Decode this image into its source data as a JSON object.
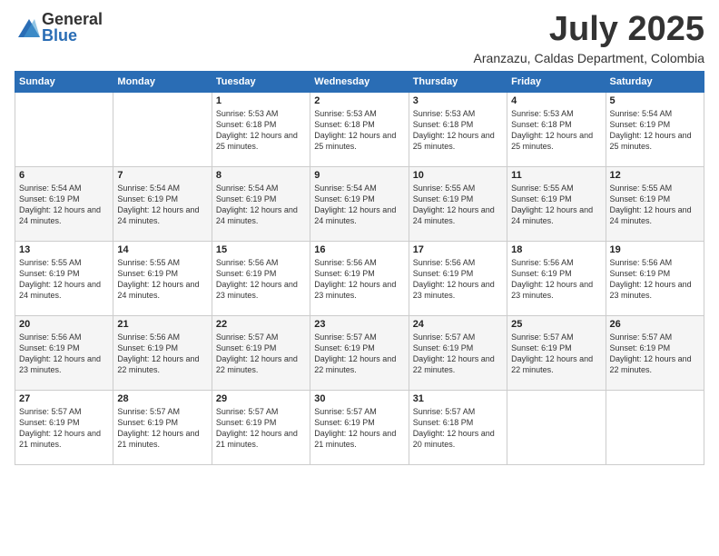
{
  "logo": {
    "general": "General",
    "blue": "Blue"
  },
  "header": {
    "month": "July 2025",
    "location": "Aranzazu, Caldas Department, Colombia"
  },
  "weekdays": [
    "Sunday",
    "Monday",
    "Tuesday",
    "Wednesday",
    "Thursday",
    "Friday",
    "Saturday"
  ],
  "weeks": [
    [
      {
        "day": "",
        "info": ""
      },
      {
        "day": "",
        "info": ""
      },
      {
        "day": "1",
        "info": "Sunrise: 5:53 AM\nSunset: 6:18 PM\nDaylight: 12 hours and 25 minutes."
      },
      {
        "day": "2",
        "info": "Sunrise: 5:53 AM\nSunset: 6:18 PM\nDaylight: 12 hours and 25 minutes."
      },
      {
        "day": "3",
        "info": "Sunrise: 5:53 AM\nSunset: 6:18 PM\nDaylight: 12 hours and 25 minutes."
      },
      {
        "day": "4",
        "info": "Sunrise: 5:53 AM\nSunset: 6:18 PM\nDaylight: 12 hours and 25 minutes."
      },
      {
        "day": "5",
        "info": "Sunrise: 5:54 AM\nSunset: 6:19 PM\nDaylight: 12 hours and 25 minutes."
      }
    ],
    [
      {
        "day": "6",
        "info": "Sunrise: 5:54 AM\nSunset: 6:19 PM\nDaylight: 12 hours and 24 minutes."
      },
      {
        "day": "7",
        "info": "Sunrise: 5:54 AM\nSunset: 6:19 PM\nDaylight: 12 hours and 24 minutes."
      },
      {
        "day": "8",
        "info": "Sunrise: 5:54 AM\nSunset: 6:19 PM\nDaylight: 12 hours and 24 minutes."
      },
      {
        "day": "9",
        "info": "Sunrise: 5:54 AM\nSunset: 6:19 PM\nDaylight: 12 hours and 24 minutes."
      },
      {
        "day": "10",
        "info": "Sunrise: 5:55 AM\nSunset: 6:19 PM\nDaylight: 12 hours and 24 minutes."
      },
      {
        "day": "11",
        "info": "Sunrise: 5:55 AM\nSunset: 6:19 PM\nDaylight: 12 hours and 24 minutes."
      },
      {
        "day": "12",
        "info": "Sunrise: 5:55 AM\nSunset: 6:19 PM\nDaylight: 12 hours and 24 minutes."
      }
    ],
    [
      {
        "day": "13",
        "info": "Sunrise: 5:55 AM\nSunset: 6:19 PM\nDaylight: 12 hours and 24 minutes."
      },
      {
        "day": "14",
        "info": "Sunrise: 5:55 AM\nSunset: 6:19 PM\nDaylight: 12 hours and 24 minutes."
      },
      {
        "day": "15",
        "info": "Sunrise: 5:56 AM\nSunset: 6:19 PM\nDaylight: 12 hours and 23 minutes."
      },
      {
        "day": "16",
        "info": "Sunrise: 5:56 AM\nSunset: 6:19 PM\nDaylight: 12 hours and 23 minutes."
      },
      {
        "day": "17",
        "info": "Sunrise: 5:56 AM\nSunset: 6:19 PM\nDaylight: 12 hours and 23 minutes."
      },
      {
        "day": "18",
        "info": "Sunrise: 5:56 AM\nSunset: 6:19 PM\nDaylight: 12 hours and 23 minutes."
      },
      {
        "day": "19",
        "info": "Sunrise: 5:56 AM\nSunset: 6:19 PM\nDaylight: 12 hours and 23 minutes."
      }
    ],
    [
      {
        "day": "20",
        "info": "Sunrise: 5:56 AM\nSunset: 6:19 PM\nDaylight: 12 hours and 23 minutes."
      },
      {
        "day": "21",
        "info": "Sunrise: 5:56 AM\nSunset: 6:19 PM\nDaylight: 12 hours and 22 minutes."
      },
      {
        "day": "22",
        "info": "Sunrise: 5:57 AM\nSunset: 6:19 PM\nDaylight: 12 hours and 22 minutes."
      },
      {
        "day": "23",
        "info": "Sunrise: 5:57 AM\nSunset: 6:19 PM\nDaylight: 12 hours and 22 minutes."
      },
      {
        "day": "24",
        "info": "Sunrise: 5:57 AM\nSunset: 6:19 PM\nDaylight: 12 hours and 22 minutes."
      },
      {
        "day": "25",
        "info": "Sunrise: 5:57 AM\nSunset: 6:19 PM\nDaylight: 12 hours and 22 minutes."
      },
      {
        "day": "26",
        "info": "Sunrise: 5:57 AM\nSunset: 6:19 PM\nDaylight: 12 hours and 22 minutes."
      }
    ],
    [
      {
        "day": "27",
        "info": "Sunrise: 5:57 AM\nSunset: 6:19 PM\nDaylight: 12 hours and 21 minutes."
      },
      {
        "day": "28",
        "info": "Sunrise: 5:57 AM\nSunset: 6:19 PM\nDaylight: 12 hours and 21 minutes."
      },
      {
        "day": "29",
        "info": "Sunrise: 5:57 AM\nSunset: 6:19 PM\nDaylight: 12 hours and 21 minutes."
      },
      {
        "day": "30",
        "info": "Sunrise: 5:57 AM\nSunset: 6:19 PM\nDaylight: 12 hours and 21 minutes."
      },
      {
        "day": "31",
        "info": "Sunrise: 5:57 AM\nSunset: 6:18 PM\nDaylight: 12 hours and 20 minutes."
      },
      {
        "day": "",
        "info": ""
      },
      {
        "day": "",
        "info": ""
      }
    ]
  ]
}
